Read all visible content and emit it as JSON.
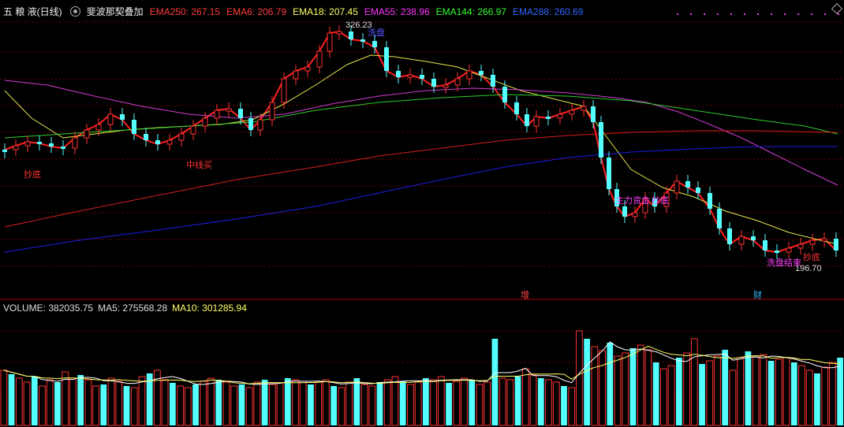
{
  "header": {
    "stock_name": "五 粮 液(日线)",
    "indicator_name": "斐波那契叠加",
    "ema_labels": [
      {
        "text": "EMA250: 267.15",
        "color": "#ff3b3b"
      },
      {
        "text": "EMA6: 206.79",
        "color": "#ff3b3b"
      },
      {
        "text": "EMA18: 207.45",
        "color": "#ffff66"
      },
      {
        "text": "EMA55: 238.96",
        "color": "#ff33ff"
      },
      {
        "text": "EMA144: 266.97",
        "color": "#33ff33"
      },
      {
        "text": "EMA288: 260.69",
        "color": "#3366ff"
      }
    ]
  },
  "volume_header": {
    "volume": "VOLUME: 382035.75",
    "ma5": "MA5: 275568.28",
    "ma10": "MA10: 301285.94"
  },
  "annotations": {
    "high_price": "326.23",
    "low_price": "196.70",
    "signal_1": "抄底",
    "signal_2": "中线买",
    "signal_3": "主力资金",
    "signal_4": "洗盘",
    "signal_5": "抄底",
    "signal_6": "洗盘结束",
    "signal_7": "抄底",
    "event_1": "增",
    "event_2": "财"
  },
  "colors": {
    "up": "#ff3232",
    "down": "#54ffff",
    "grid": "#7a0000",
    "ema6": "#ff2020",
    "ema18": "#e6e64c",
    "ema55": "#d23cd2",
    "ema144": "#2ecc2e",
    "ema250": "#d21e1e",
    "ema288": "#1e1ee6"
  },
  "chart_data": {
    "type": "candlestick",
    "price_range": [
      190,
      330
    ],
    "high": 326.23,
    "low": 196.7,
    "ema_series": [
      "EMA6",
      "EMA18",
      "EMA55",
      "EMA144",
      "EMA250",
      "EMA288"
    ],
    "volume_series": [
      "VOLUME",
      "MA5",
      "MA10"
    ]
  }
}
